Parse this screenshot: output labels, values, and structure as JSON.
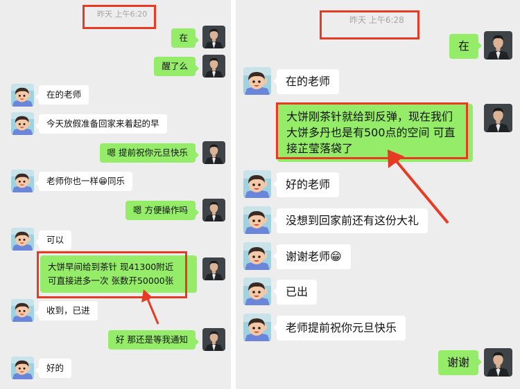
{
  "left": {
    "timestamp": "昨天 上午6:20",
    "messages": {
      "m1": "在",
      "m2": "醒了么",
      "m3": "在的老师",
      "m4": "今天放假准备回家来着起的早",
      "m5": "嗯 提前祝你元旦快乐",
      "m6a": "老师你也一样",
      "m6_emoji": "😁",
      "m6b": "同乐",
      "m7": "嗯 方便操作吗",
      "m8": "可以",
      "m9_line1": "大饼早间给到茶针 现41300附近",
      "m9_line2": "可直接进多一次 张数开50000张",
      "m10": "收到，已进",
      "m11": "好 那还是等我通知",
      "m12": "好的"
    }
  },
  "right": {
    "timestamp": "昨天 上午6:28",
    "messages": {
      "r1": "在",
      "r2": "在的老师",
      "r3_line1": "大饼刚茶针就给到反弹，现在我们",
      "r3_line2": "大饼多丹也是有500点的空间 可直",
      "r3_line3": "接芷莹落袋了",
      "r4": "好的老师",
      "r5": "没想到回家前还有这份大礼",
      "r6a": "谢谢老师",
      "r6_emoji": "😁",
      "r7": "已出",
      "r8": "老师提前祝你元旦快乐",
      "r9": "谢谢"
    }
  },
  "colors": {
    "chat_background": "#ededed",
    "outgoing_bubble": "#95ec69",
    "incoming_bubble": "#ffffff",
    "annotation_red": "#e63a23"
  },
  "icons": {
    "user_avatar": "man-in-suit-avatar",
    "contact_avatar": "cartoon-boy-avatar"
  }
}
